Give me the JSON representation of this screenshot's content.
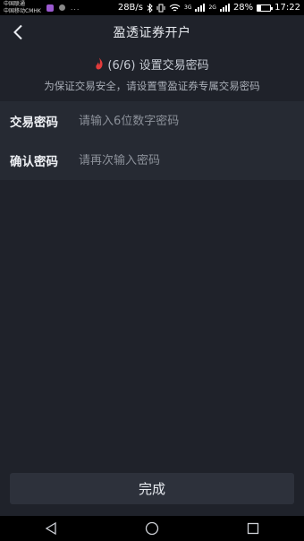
{
  "status_bar": {
    "carrier_line1": "中国联通",
    "carrier_line2": "中国移动CMHK",
    "notif_dots": "...",
    "net_speed": "28B/s",
    "net_type": "3G",
    "net_type2": "2G",
    "battery_percent": "28%",
    "battery_level": 0.28,
    "time": "17:22",
    "icons": [
      "bluetooth-icon",
      "vibrate-icon",
      "wifi-icon",
      "signal-icon",
      "battery-icon"
    ]
  },
  "header": {
    "back_icon": "chevron-left-icon",
    "title": "盈透证券开户"
  },
  "step": {
    "icon": "flame-icon",
    "accent_color": "#e23b3b",
    "text": "(6/6) 设置交易密码"
  },
  "hint": "为保证交易安全，请设置雪盈证券专属交易密码",
  "form": {
    "fields": [
      {
        "label": "交易密码",
        "placeholder": "请输入6位数字密码",
        "value": ""
      },
      {
        "label": "确认密码",
        "placeholder": "请再次输入密码",
        "value": ""
      }
    ]
  },
  "done_button": {
    "label": "完成"
  },
  "nav_bar": {
    "icons": [
      "back-triangle-icon",
      "home-circle-icon",
      "recents-square-icon"
    ]
  }
}
